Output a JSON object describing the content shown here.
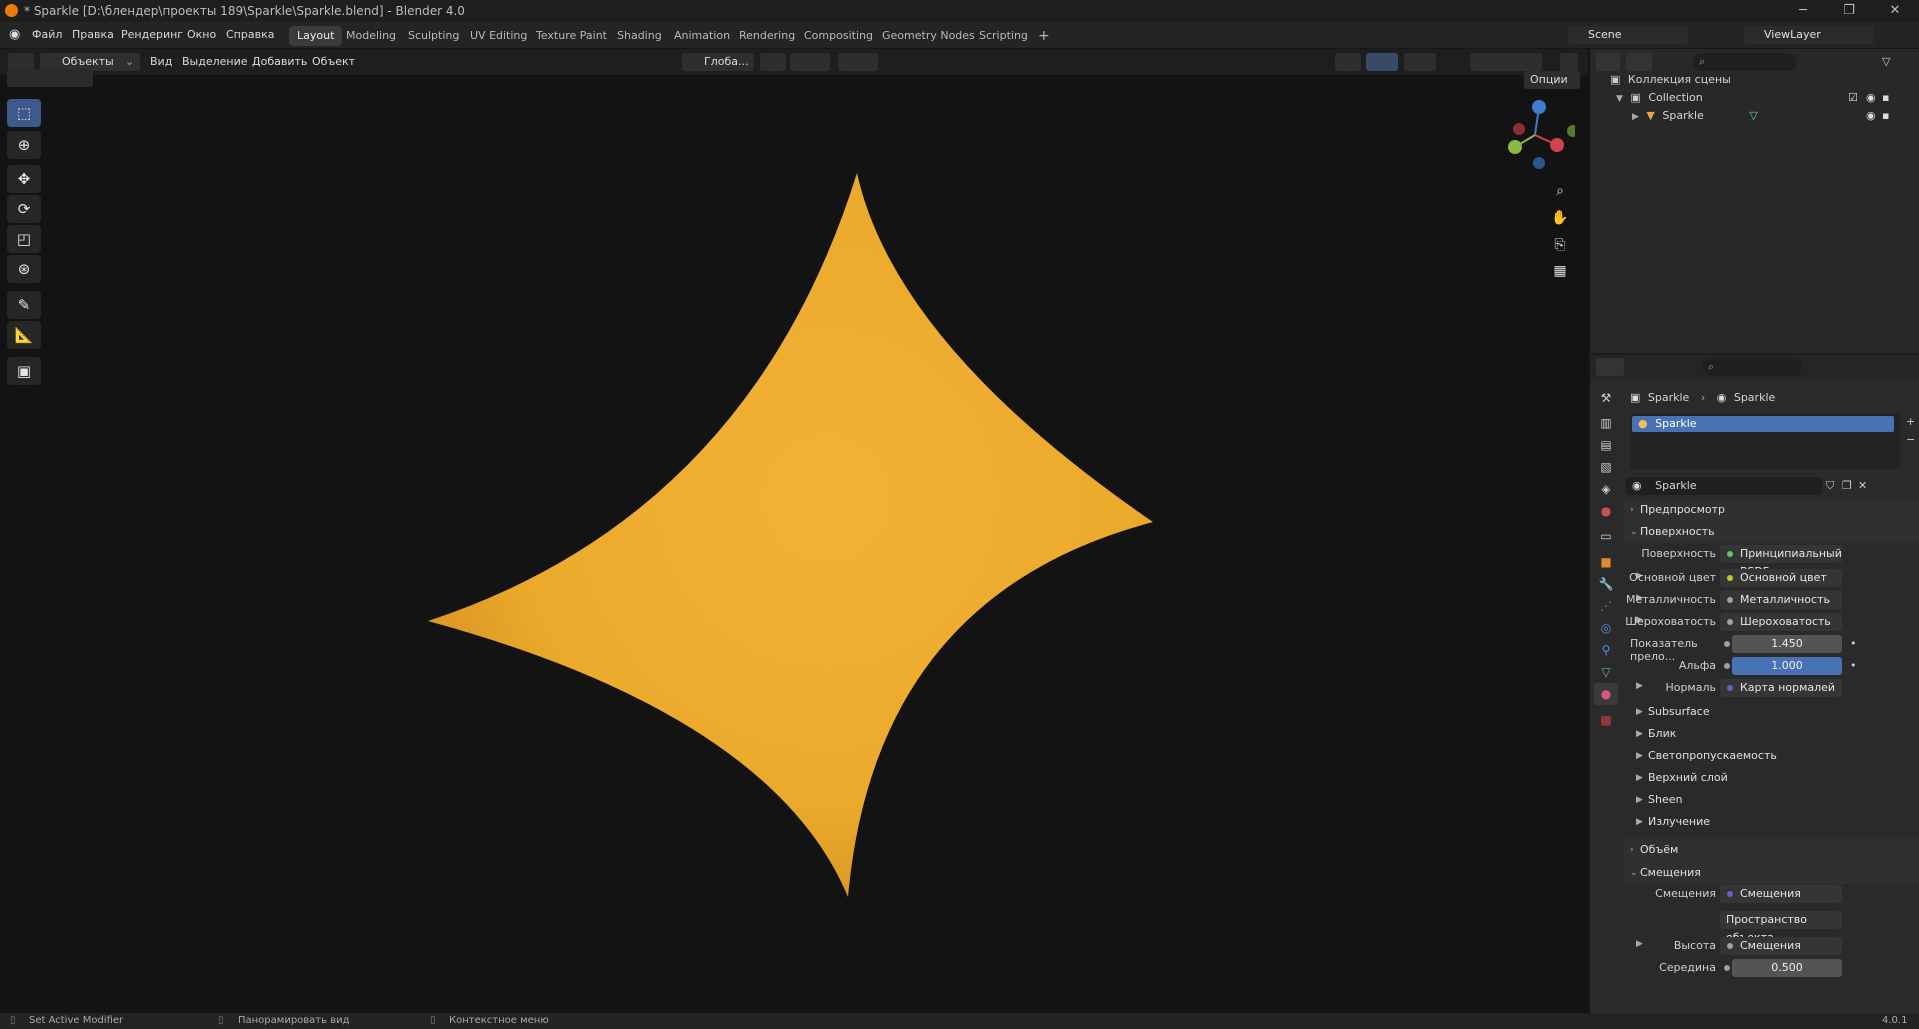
{
  "window": {
    "title": "* Sparkle [D:\\блендер\\проекты 189\\Sparkle\\Sparkle.blend] - Blender 4.0",
    "minimize": "─",
    "maximize": "❐",
    "close": "✕"
  },
  "menubar": {
    "items": [
      "Файл",
      "Правка",
      "Рендеринг",
      "Окно",
      "Справка"
    ]
  },
  "workspaces": {
    "tabs": [
      "Layout",
      "Modeling",
      "Sculpting",
      "UV Editing",
      "Texture Paint",
      "Shading",
      "Animation",
      "Rendering",
      "Compositing",
      "Geometry Nodes",
      "Scripting"
    ],
    "active": "Layout",
    "add": "+"
  },
  "scene": {
    "name": "Scene",
    "view_layer": "ViewLayer"
  },
  "viewport_header": {
    "mode": "Объекты",
    "menus": [
      "Вид",
      "Выделение",
      "Добавить",
      "Объект"
    ],
    "orientation": "Глоба...",
    "options": "Опции"
  },
  "outliner": {
    "root": "Коллекция сцены",
    "collection": "Collection",
    "object": "Sparkle"
  },
  "properties": {
    "breadcrumb_object": "Sparkle",
    "breadcrumb_material": "Sparkle",
    "slot": "Sparkle",
    "material_name": "Sparkle",
    "sections": {
      "preview": "Предпросмотр",
      "surface": "Поверхность",
      "volume": "Объём",
      "displacement": "Смещения"
    },
    "surface_label": "Поверхность",
    "surface_value": "Принципиальный BSDF",
    "inputs": [
      {
        "label": "Основной цвет",
        "value": "Основной цвет"
      },
      {
        "label": "Металличность",
        "value": "Металличность"
      },
      {
        "label": "Шероховатость",
        "value": "Шероховатость"
      }
    ],
    "ior_label": "Показатель прело...",
    "ior_value": "1.450",
    "alpha_label": "Альфа",
    "alpha_value": "1.000",
    "normal_label": "Нормаль",
    "normal_value": "Карта нормалей",
    "subpanels": [
      "Subsurface",
      "Блик",
      "Светопропускаемость",
      "Верхний слой",
      "Sheen",
      "Излучение"
    ],
    "disp_label": "Смещения",
    "disp_value": "Смещения",
    "disp_space": "Пространство объекта",
    "height_label": "Высота",
    "height_value": "Смещения",
    "mid_label": "Середина",
    "mid_value": "0.500"
  },
  "statusbar": {
    "left": "Set Active Modifier",
    "middle": "Панорамировать вид",
    "right": "Контекстное меню",
    "version": "4.0.1"
  },
  "colors": {
    "accent": "#4772b3",
    "sparkle": "#f0ab2a"
  }
}
